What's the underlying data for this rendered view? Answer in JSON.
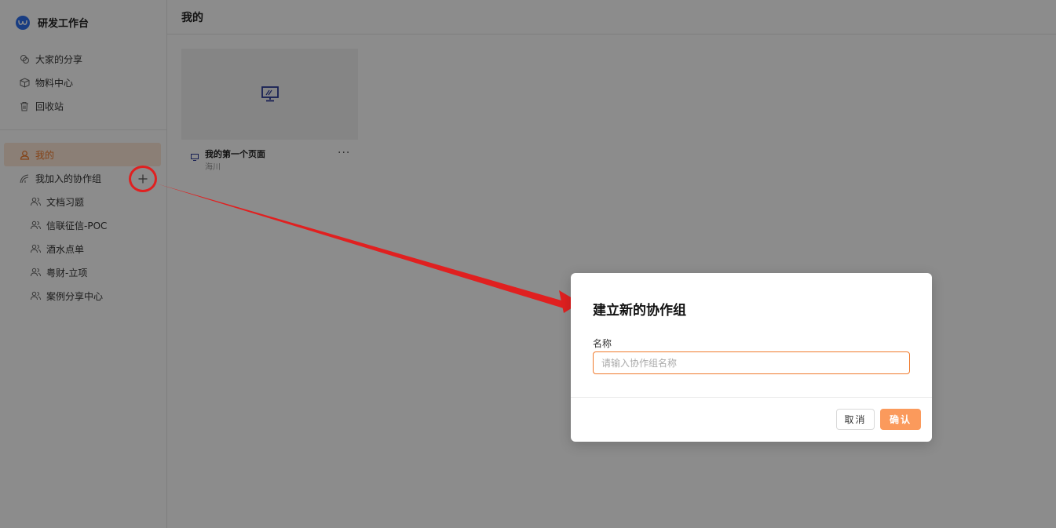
{
  "app": {
    "title": "研发工作台",
    "brand_color": "#2f6fed",
    "accent_color": "#f07a2c"
  },
  "sidebar": {
    "top_items": [
      {
        "label": "大家的分享",
        "icon": "share-icon"
      },
      {
        "label": "物料中心",
        "icon": "cube-icon"
      },
      {
        "label": "回收站",
        "icon": "trash-icon"
      }
    ],
    "mine": {
      "label": "我的",
      "icon": "user-icon"
    },
    "groups_header": {
      "label": "我加入的协作组",
      "icon": "collab-icon",
      "add_icon": "plus-icon"
    },
    "groups": [
      {
        "label": "文档习题",
        "icon": "group-icon"
      },
      {
        "label": "信联征信-POC",
        "icon": "group-icon"
      },
      {
        "label": "酒水点单",
        "icon": "group-icon"
      },
      {
        "label": "粤财-立项",
        "icon": "group-icon"
      },
      {
        "label": "案例分享中心",
        "icon": "group-icon"
      }
    ]
  },
  "main": {
    "title": "我的",
    "cards": [
      {
        "title": "我的第一个页面",
        "owner": "海川",
        "thumb_icon": "monitor-icon",
        "more_label": "···"
      }
    ]
  },
  "modal": {
    "title": "建立新的协作组",
    "field_label": "名称",
    "input_placeholder": "请输入协作组名称",
    "input_value": "",
    "cancel_label": "取消",
    "confirm_label": "确认",
    "confirm_color": "#fb9a5c"
  },
  "annotation": {
    "color": "#e02020"
  }
}
